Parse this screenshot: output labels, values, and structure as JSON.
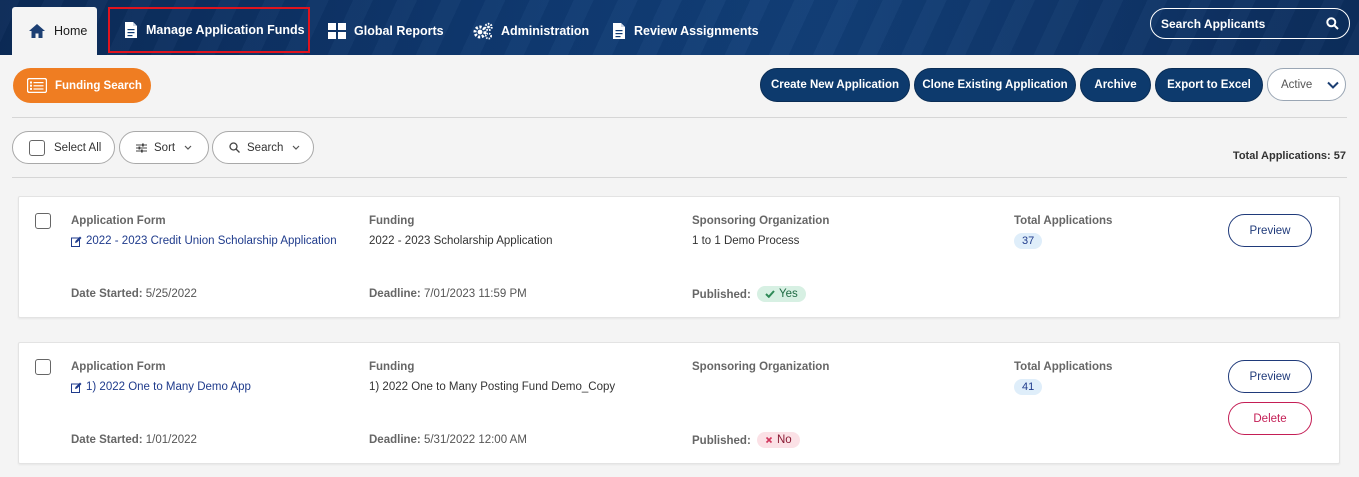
{
  "nav": {
    "tabs": [
      {
        "label": "Home",
        "icon": "home-icon"
      },
      {
        "label": "Manage Application Funds",
        "icon": "document-icon"
      },
      {
        "label": "Global Reports",
        "icon": "grid-icon"
      },
      {
        "label": "Administration",
        "icon": "gears-icon"
      },
      {
        "label": "Review Assignments",
        "icon": "document-icon"
      }
    ],
    "search_placeholder": "Search Applicants"
  },
  "toolbar": {
    "funding_search": "Funding Search",
    "create": "Create New Application",
    "clone": "Clone Existing Application",
    "archive": "Archive",
    "export": "Export to Excel",
    "status_value": "Active"
  },
  "filters": {
    "select_all": "Select All",
    "sort": "Sort",
    "search": "Search",
    "total_label": "Total Applications: 57"
  },
  "labels": {
    "application_form": "Application Form",
    "funding": "Funding",
    "sponsoring_org": "Sponsoring Organization",
    "total_applications": "Total Applications",
    "date_started": "Date Started:",
    "deadline": "Deadline:",
    "published": "Published:"
  },
  "cards": [
    {
      "form_name": "2022 - 2023 Credit Union Scholarship Application",
      "funding": "2022 - 2023 Scholarship Application",
      "sponsor": "1 to 1 Demo Process",
      "total": "37",
      "date_started": "5/25/2022",
      "deadline": "7/01/2023 11:59 PM",
      "published": "Yes",
      "preview": "Preview"
    },
    {
      "form_name": "1) 2022 One to Many Demo App",
      "funding": "1) 2022 One to Many Posting Fund Demo_Copy",
      "sponsor": "",
      "total": "41",
      "date_started": "1/01/2022",
      "deadline": "5/31/2022 12:00 AM",
      "published": "No",
      "preview": "Preview",
      "delete": "Delete"
    }
  ],
  "colors": {
    "nav_bg": "#0f3a72",
    "accent_orange": "#ef7d22",
    "button_dark": "#0d3a6d",
    "highlight_red": "#e0141e",
    "delete_red": "#c41e55"
  }
}
